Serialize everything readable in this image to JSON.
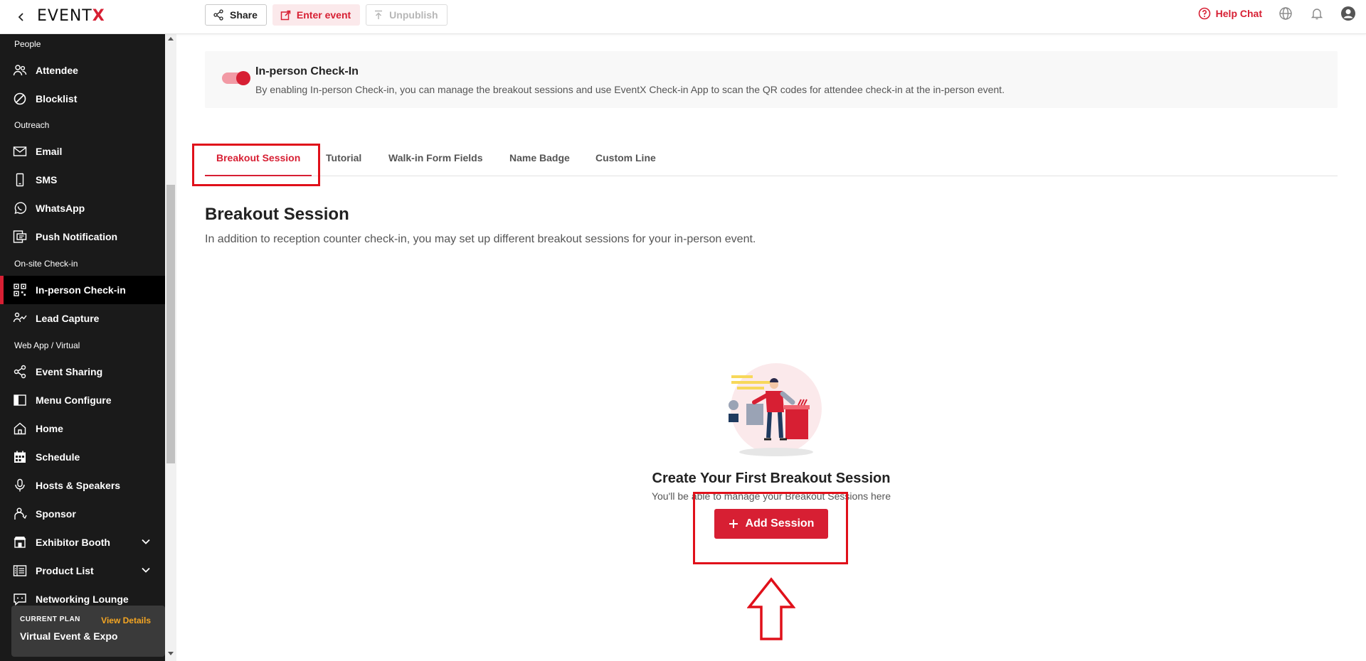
{
  "header": {
    "logo_main": "EVENT",
    "logo_accent": "X",
    "share_label": "Share",
    "enter_label": "Enter event",
    "unpublish_label": "Unpublish",
    "help_label": "Help Chat"
  },
  "sidebar": {
    "sections": {
      "people": "People",
      "outreach": "Outreach",
      "onsite": "On-site Check-in",
      "webapp": "Web App / Virtual"
    },
    "items": {
      "attendee": "Attendee",
      "blocklist": "Blocklist",
      "email": "Email",
      "sms": "SMS",
      "whatsapp": "WhatsApp",
      "push": "Push Notification",
      "checkin": "In-person Check-in",
      "lead": "Lead Capture",
      "sharing": "Event Sharing",
      "menu": "Menu Configure",
      "home": "Home",
      "schedule": "Schedule",
      "hosts": "Hosts & Speakers",
      "sponsor": "Sponsor",
      "exhibitor": "Exhibitor Booth",
      "product": "Product List",
      "networking": "Networking Lounge"
    },
    "plan": {
      "label": "CURRENT PLAN",
      "link": "View Details",
      "name": "Virtual Event & Expo"
    }
  },
  "banner": {
    "title": "In-person Check-In",
    "description": "By enabling In-person Check-in, you can manage the breakout sessions and use EventX Check-in App to scan the QR codes for attendee check-in at the in-person event.",
    "enabled": true
  },
  "tabs": {
    "breakout": "Breakout Session",
    "tutorial": "Tutorial",
    "walkin": "Walk-in Form Fields",
    "badge": "Name Badge",
    "custom": "Custom Line"
  },
  "section": {
    "title": "Breakout Session",
    "description": "In addition to reception counter check-in, you may set up different breakout sessions for your in-person event."
  },
  "empty_state": {
    "title": "Create Your First Breakout Session",
    "description": "You'll be able to manage your Breakout Sessions here",
    "button_label": "Add Session"
  },
  "colors": {
    "brand": "#d71f33",
    "sidebar_bg": "#1a1a1a",
    "annotation": "#e0101a",
    "plan_link": "#f5a623"
  }
}
